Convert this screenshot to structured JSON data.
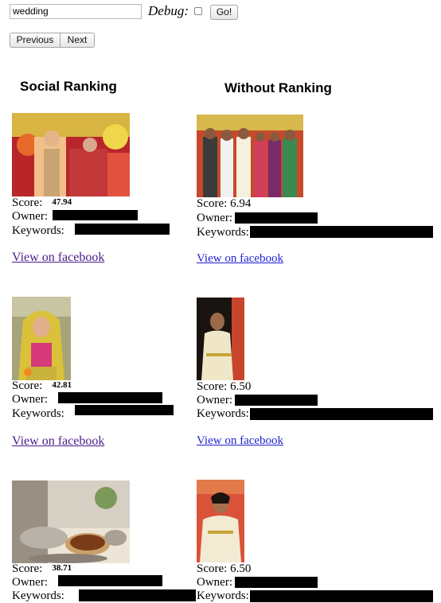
{
  "search": {
    "value": "wedding"
  },
  "debug": {
    "label": "Debug:",
    "checked": false
  },
  "buttons": {
    "go": "Go!",
    "previous": "Previous",
    "next": "Next"
  },
  "columns": {
    "social": {
      "heading": "Social Ranking",
      "items": [
        {
          "score_label": "Score:",
          "score": "47.94",
          "owner_label": "Owner:",
          "keywords_label": "Keywords:",
          "link": "View on facebook"
        },
        {
          "score_label": "Score:",
          "score": "42.81",
          "owner_label": "Owner:",
          "keywords_label": "Keywords:",
          "link": "View on facebook"
        },
        {
          "score_label": "Score:",
          "score": "38.71",
          "owner_label": "Owner:",
          "keywords_label": "Keywords:"
        }
      ]
    },
    "plain": {
      "heading": "Without Ranking",
      "items": [
        {
          "score_text": "Score: 6.94",
          "owner_label": "Owner:",
          "keywords_label": "Keywords:",
          "link": "View on facebook"
        },
        {
          "score_text": "Score: 6.50",
          "owner_label": "Owner:",
          "keywords_label": "Keywords:",
          "link": "View on facebook"
        },
        {
          "score_text": "Score: 6.50",
          "owner_label": "Owner:",
          "keywords_label": "Keywords:"
        }
      ]
    }
  },
  "colors": {
    "visited_link": "#4b1a8a",
    "link": "#1f1fd1",
    "redaction": "#000000"
  }
}
